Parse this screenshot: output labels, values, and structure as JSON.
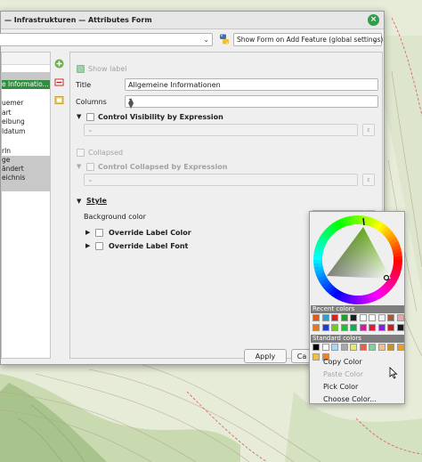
{
  "window": {
    "title": "— Infrastrukturen — Attributes Form"
  },
  "toolbar": {
    "form_mode": "Show Form on Add Feature (global settings)"
  },
  "tree": {
    "items": [
      {
        "label": "e Informatio...",
        "state": "selected"
      },
      {
        "label": "uemer",
        "state": "normal"
      },
      {
        "label": "art",
        "state": "normal"
      },
      {
        "label": "eibung",
        "state": "normal"
      },
      {
        "label": "ldatum",
        "state": "normal"
      },
      {
        "label": "rIn",
        "state": "normal"
      },
      {
        "label": "ge",
        "state": "gray"
      },
      {
        "label": "ändert",
        "state": "gray"
      },
      {
        "label": "eichnis",
        "state": "gray"
      }
    ]
  },
  "props": {
    "show_label": "Show label",
    "title_label": "Title",
    "title_value": "Allgemeine Informationen",
    "columns_label": "Columns",
    "columns_value": "1",
    "visibility_expr": "Control Visibility by Expression",
    "collapsed": "Collapsed",
    "collapsed_expr": "Control Collapsed by Expression",
    "style": "Style",
    "bg_color": "Background color",
    "override_color": "Override Label Color",
    "override_font": "Override Label Font",
    "eps_glyph": "ε"
  },
  "buttons": {
    "apply": "Apply",
    "cancel": "Ca"
  },
  "colorpopup": {
    "recent_colors": "Recent colors",
    "standard_colors": "Standard colors",
    "recent": [
      "#e05a1a",
      "#2fa0c8",
      "#d92020",
      "#20a020",
      "#1c1c1c",
      "#ffffff",
      "#ffffff",
      "#f0f0f0",
      "#a05a3a",
      "#e8a8a8",
      "#e8781e",
      "#1c3fd8",
      "#6ad01c",
      "#20c030",
      "#18a858",
      "#d8189c",
      "#e0183c",
      "#8a1ee0",
      "#c82020",
      "#1a1a1a"
    ],
    "standard": [
      "#000000",
      "#ffffff",
      "#a8d8f8",
      "#a8a8a8",
      "#e8e870",
      "#e86040",
      "#80d0a0",
      "#f0c090",
      "#d09020",
      "#e8a020",
      "#f0c040",
      "#f08020"
    ],
    "menu": {
      "copy": "Copy Color",
      "paste": "Paste Color",
      "pick": "Pick Color",
      "choose": "Choose Color..."
    }
  }
}
